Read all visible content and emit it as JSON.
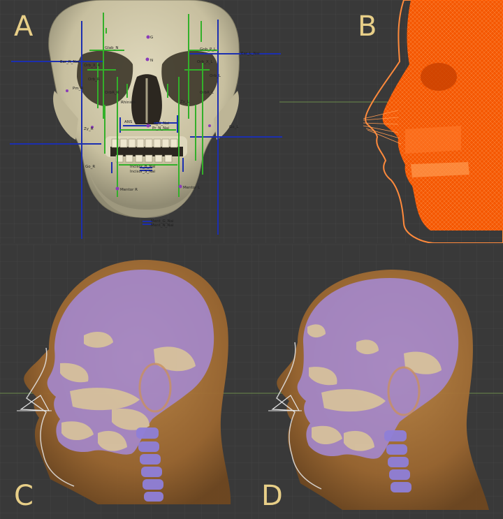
{
  "panels": {
    "a": {
      "letter": "A"
    },
    "b": {
      "letter": "B"
    },
    "c": {
      "letter": "C"
    },
    "d": {
      "letter": "D"
    }
  },
  "landmarks": {
    "g": "G",
    "glab_n": "Glab_N",
    "glab_tfl": "Gnb_P_L",
    "ear_r": "Ear_R_Nai",
    "ear_l": "Ear_L_Nai",
    "orb_x_r": "Orb_X_R",
    "orb_x_l": "Orb_X_L",
    "orb_r": "Orb_R",
    "orb_l": "Orb_L",
    "orb_r_r": "OrbR_R",
    "orb_r_l": "OrbR_L",
    "n": "N",
    "zy_r": "Zy_R",
    "zy_l": "Zy_L",
    "rhine": "Rhinion",
    "ans": "ANS",
    "prn": "Pm_R",
    "pr_r": "Pr_G_Nai",
    "pr_l": "Pr_N_Nai",
    "go_r": "Go_R",
    "go_l": "Go_L",
    "ment_r": "Mentor R",
    "ment_l": "Mentor L",
    "ment_g": "Ment_G_Nai",
    "ment_n": "Ment_N_Nai",
    "inc": "Incisor_B_Nai",
    "inc2": "Incisor_S_Nai"
  },
  "colors": {
    "background": "#393939",
    "grid": "#444444",
    "bone": "#cfc7a8",
    "bone_shadow": "#8f8a72",
    "soft_tissue_mesh": "#ff5a00",
    "skin": "#a8702f",
    "skull_overlay": "#a48ad6",
    "guide_blue": "#1c2fb0",
    "guide_green": "#33b02a",
    "letter": "#e8cf88"
  }
}
